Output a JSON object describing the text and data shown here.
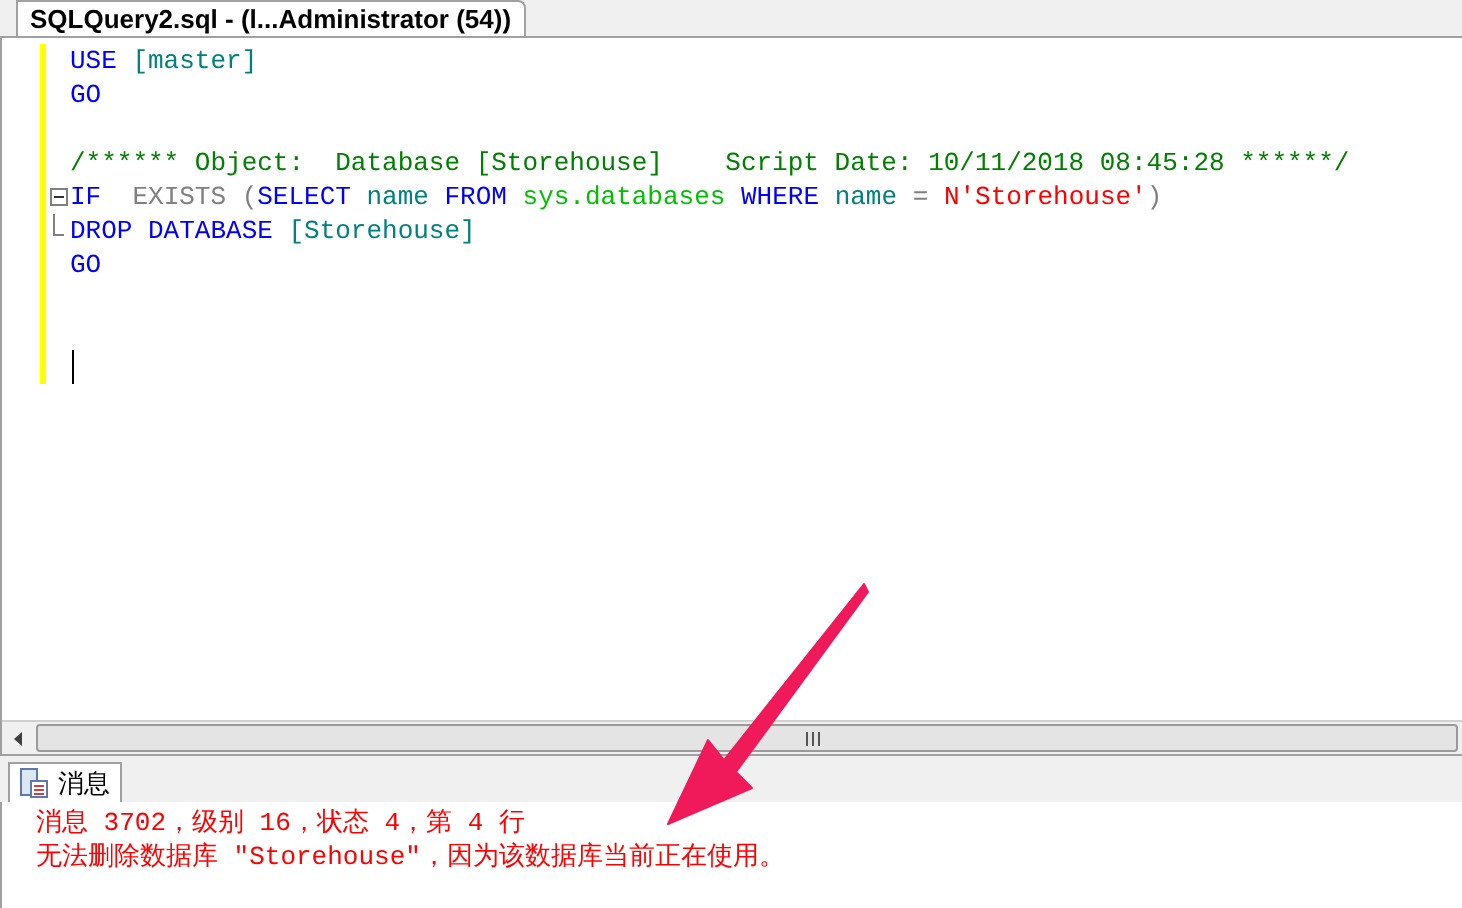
{
  "editor_tab": {
    "title": "SQLQuery2.sql - (l...Administrator (54))",
    "selected": true
  },
  "code_lines": [
    {
      "kind": "code",
      "tokens": [
        {
          "kind": "keyword",
          "text": "USE"
        },
        {
          "kind": "identifier",
          "text": " [master]"
        }
      ]
    },
    {
      "kind": "code",
      "tokens": [
        {
          "kind": "keyword",
          "text": "GO"
        }
      ]
    },
    {
      "kind": "blank"
    },
    {
      "kind": "code",
      "tokens": [
        {
          "kind": "comment",
          "text": "/****** Object:  Database [Storehouse]    Script Date: 10/11/2018 08:45:28 ******/"
        }
      ]
    },
    {
      "kind": "fold-start",
      "tokens": [
        {
          "kind": "keyword",
          "text": "IF"
        },
        {
          "kind": "operator",
          "text": "  EXISTS ("
        },
        {
          "kind": "keyword",
          "text": "SELECT"
        },
        {
          "kind": "identifier",
          "text": " name "
        },
        {
          "kind": "keyword",
          "text": "FROM"
        },
        {
          "kind": "system",
          "text": " sys.databases "
        },
        {
          "kind": "keyword",
          "text": "WHERE"
        },
        {
          "kind": "identifier",
          "text": " name "
        },
        {
          "kind": "operator",
          "text": "= "
        },
        {
          "kind": "string",
          "text": "N'Storehouse'"
        },
        {
          "kind": "operator",
          "text": ")"
        }
      ]
    },
    {
      "kind": "fold-end",
      "tokens": [
        {
          "kind": "keyword",
          "text": "DROP DATABASE"
        },
        {
          "kind": "identifier",
          "text": " [Storehouse]"
        }
      ]
    },
    {
      "kind": "code",
      "tokens": [
        {
          "kind": "keyword",
          "text": "GO"
        }
      ]
    },
    {
      "kind": "blank"
    },
    {
      "kind": "blank"
    },
    {
      "kind": "caret"
    }
  ],
  "results_tab": {
    "label": "消息",
    "selected": true
  },
  "messages": [
    "消息 3702，级别 16，状态 4，第 4 行",
    "无法删除数据库 \"Storehouse\"，因为该数据库当前正在使用。"
  ]
}
